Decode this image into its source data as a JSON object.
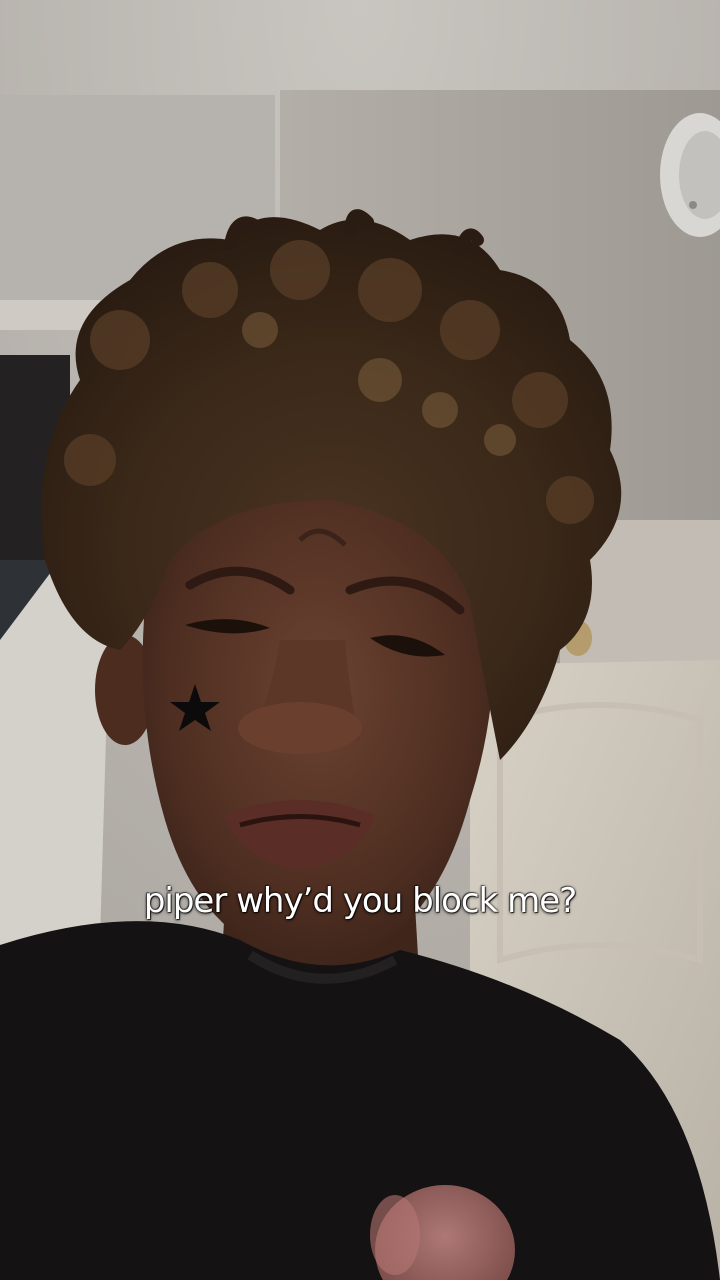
{
  "video": {
    "caption": "piper why’d you block me?"
  }
}
